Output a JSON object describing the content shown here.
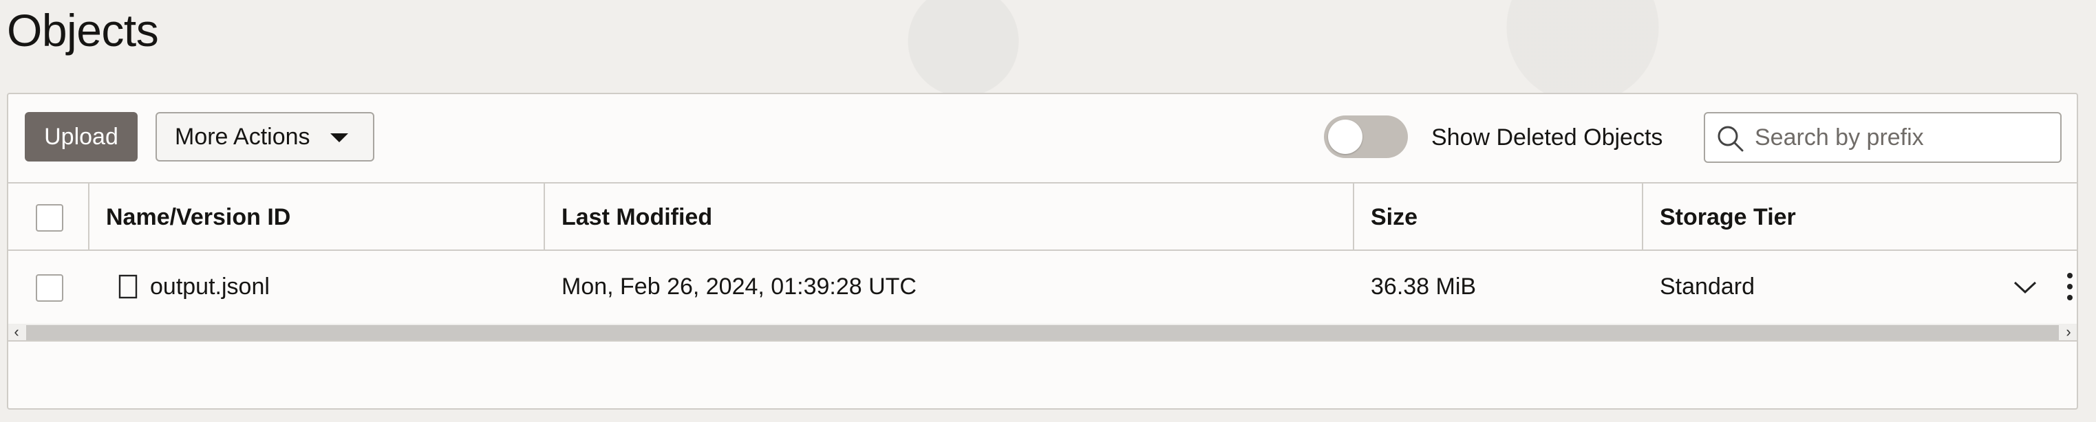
{
  "page": {
    "title": "Objects"
  },
  "toolbar": {
    "upload_label": "Upload",
    "more_actions_label": "More Actions",
    "toggle_label": "Show Deleted Objects",
    "toggle_state": "off",
    "search_placeholder": "Search by prefix",
    "search_value": ""
  },
  "table": {
    "columns": [
      "Name/Version ID",
      "Last Modified",
      "Size",
      "Storage Tier"
    ],
    "rows": [
      {
        "name": "output.jsonl",
        "last_modified": "Mon, Feb 26, 2024, 01:39:28 UTC",
        "size": "36.38 MiB",
        "storage_tier": "Standard"
      }
    ]
  },
  "scrollbar": {
    "left_arrow": "‹",
    "right_arrow": "›"
  },
  "colors": {
    "primary_button": "#6f6864",
    "background": "#f1efec",
    "panel": "#fcfbfa"
  }
}
